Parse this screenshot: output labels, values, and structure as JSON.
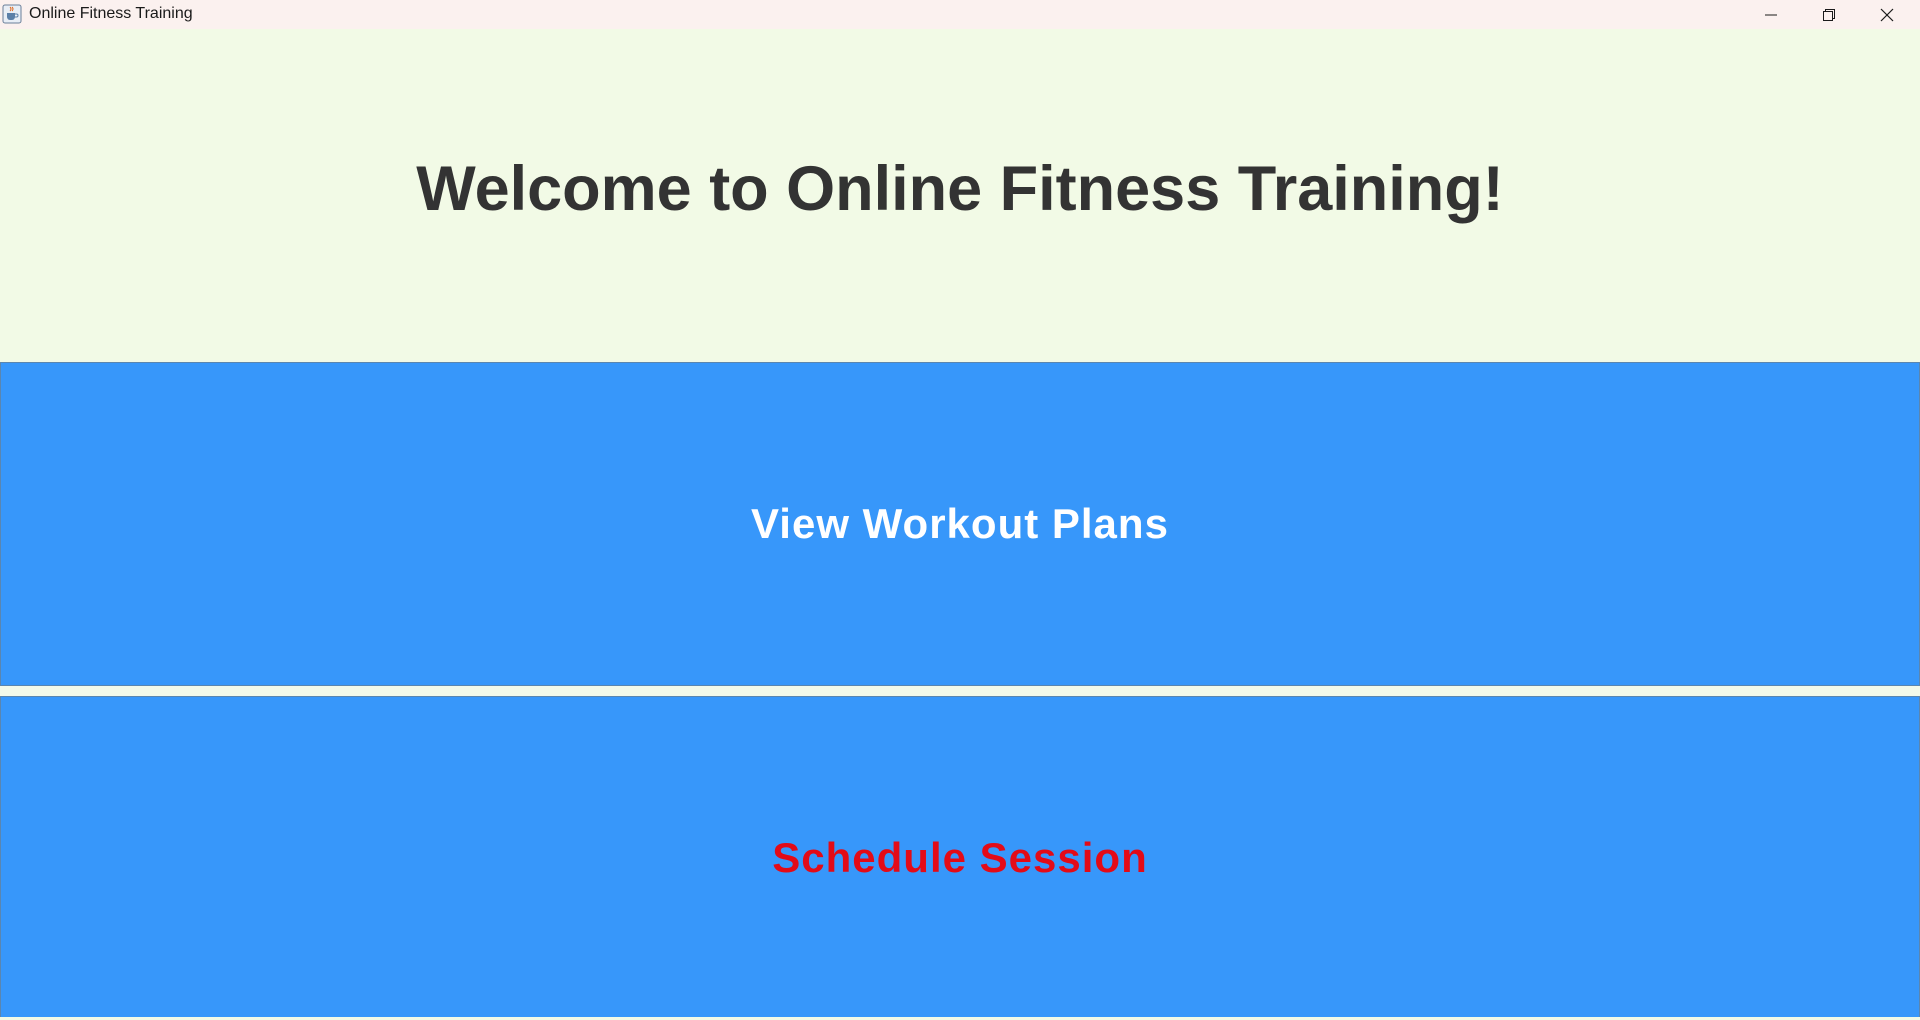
{
  "window": {
    "title": "Online Fitness Training",
    "app_icon": "java-cup-icon",
    "controls": {
      "minimize_icon": "minimize-icon",
      "maximize_icon": "restore-icon",
      "close_icon": "close-icon"
    }
  },
  "header": {
    "title": "Welcome to Online Fitness Training!"
  },
  "buttons": {
    "workout_plans": "View Workout Plans",
    "schedule_session": "Schedule Session"
  },
  "colors": {
    "background": "#f2fae6",
    "button_bg": "#3797fa",
    "workout_label": "#ffffff",
    "schedule_label": "#e30b17",
    "title_text": "#333333"
  }
}
